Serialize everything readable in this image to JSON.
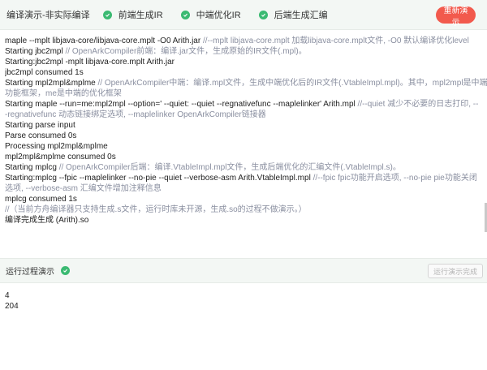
{
  "header": {
    "title": "编译演示-非实际编译",
    "steps": [
      {
        "label": "前端生成IR"
      },
      {
        "label": "中端优化IR"
      },
      {
        "label": "后端生成汇编"
      }
    ],
    "restart_label": "重新演示"
  },
  "console": {
    "lines": [
      {
        "cmd": "maple --mplt libjava-core/libjava-core.mplt -O0 Arith.jar ",
        "cmt": "//--mplt libjava-core.mplt 加载libjava-core.mplt文件, -O0 默认编译优化level"
      },
      {
        "cmd": "Starting jbc2mpl ",
        "cmt": "// OpenArkCompiler前端：编译.jar文件，生成原始的IR文件(.mpl)。"
      },
      {
        "cmd": "Starting:jbc2mpl -mplt libjava-core.mplt Arith.jar",
        "cmt": ""
      },
      {
        "cmd": "jbc2mpl consumed 1s",
        "cmt": ""
      },
      {
        "cmd": "Starting mpl2mpl&mplme ",
        "cmt": "// OpenArkCompiler中端：编译.mpl文件，生成中端优化后的IR文件(.VtableImpl.mpl)。其中，mpl2mpl是中端的"
      },
      {
        "cmd": "",
        "cmt": "功能框架，me是中端的优化框架"
      },
      {
        "cmd": "Starting maple --run=me:mpl2mpl --option=' --quiet: --quiet --regnativefunc --maplelinker' Arith.mpl ",
        "cmt": "//--quiet 减少不必要的日志打印, --"
      },
      {
        "cmd": "",
        "cmt": "-regnativefunc 动态链接绑定选项, --maplelinker OpenArkCompiler链接器"
      },
      {
        "cmd": "Starting parse input",
        "cmt": ""
      },
      {
        "cmd": "Parse consumed 0s",
        "cmt": ""
      },
      {
        "cmd": "Processing mpl2mpl&mplme",
        "cmt": ""
      },
      {
        "cmd": "mpl2mpl&mplme consumed 0s",
        "cmt": ""
      },
      {
        "cmd": "Starting mplcg ",
        "cmt": "// OpenArkCompiler后端：编译.VtableImpl.mpl文件，生成后端优化的汇编文件(.VtableImpl.s)。"
      },
      {
        "cmd": "Starting:mplcg --fpic --maplelinker --no-pie --quiet --verbose-asm Arith.VtableImpl.mpl ",
        "cmt": "//--fpic fpic功能开启选项, --no-pie pie功能关闭"
      },
      {
        "cmd": "",
        "cmt": "选项, --verbose-asm 汇编文件增加注释信息"
      },
      {
        "cmd": "mplcg consumed 1s",
        "cmt": ""
      },
      {
        "cmd": "",
        "cmt": "//（当前方舟编译器只支持生成.s文件，运行时库未开源，生成.so的过程不做演示。）"
      },
      {
        "cmd": "编译完成生成 (Arith).so",
        "cmt": ""
      }
    ]
  },
  "run": {
    "label": "运行过程演示",
    "done_label": "运行演示完成",
    "output": [
      "4",
      "204"
    ]
  },
  "colors": {
    "accent_green": "#3bba72",
    "restart_red": "#f25a4d",
    "comment_gray": "#8a8fa0"
  },
  "icons": {
    "step_status": "check-circle-icon"
  }
}
